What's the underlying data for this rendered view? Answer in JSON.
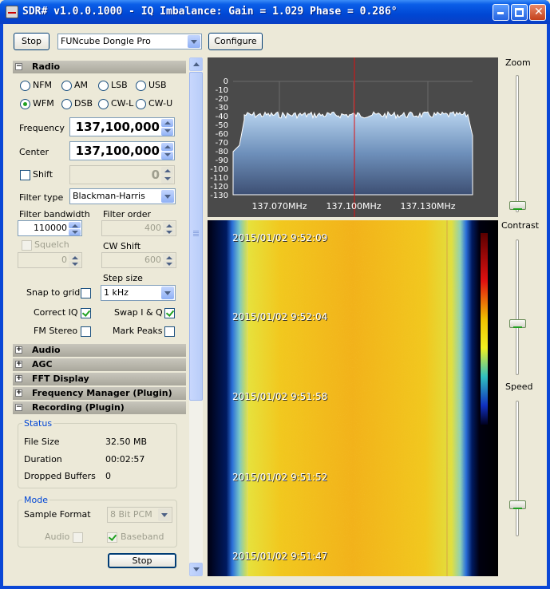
{
  "window": {
    "title": "SDR# v1.0.0.1000 - IQ Imbalance: Gain = 1.029 Phase = 0.286°"
  },
  "toolbar": {
    "stop_label": "Stop",
    "device": "FUNcube Dongle Pro",
    "configure_label": "Configure"
  },
  "radio": {
    "section_title": "Radio",
    "modes": [
      "NFM",
      "AM",
      "LSB",
      "USB",
      "WFM",
      "DSB",
      "CW-L",
      "CW-U"
    ],
    "selected_mode": "WFM",
    "frequency_label": "Frequency",
    "frequency_value": "137,100,000",
    "center_label": "Center",
    "center_value": "137,100,000",
    "shift_label": "Shift",
    "shift_value": "0",
    "filter_type_label": "Filter type",
    "filter_type_value": "Blackman-Harris",
    "filter_bandwidth_label": "Filter bandwidth",
    "filter_bandwidth_value": "110000",
    "filter_order_label": "Filter order",
    "filter_order_value": "400",
    "squelch_label": "Squelch",
    "squelch_value": "0",
    "cw_shift_label": "CW Shift",
    "cw_shift_value": "600",
    "step_size_label": "Step size",
    "snap_to_grid_label": "Snap to grid",
    "step_size_value": "1 kHz",
    "correct_iq_label": "Correct IQ",
    "swap_iq_label": "Swap I & Q",
    "fm_stereo_label": "FM Stereo",
    "mark_peaks_label": "Mark Peaks"
  },
  "sections": [
    "Audio",
    "AGC",
    "FFT Display",
    "Frequency Manager (Plugin)",
    "Recording (Plugin)"
  ],
  "recording": {
    "status_title": "Status",
    "file_size_label": "File Size",
    "file_size_value": "32.50 MB",
    "duration_label": "Duration",
    "duration_value": "00:02:57",
    "dropped_label": "Dropped Buffers",
    "dropped_value": "0",
    "mode_title": "Mode",
    "sample_format_label": "Sample Format",
    "sample_format_value": "8 Bit PCM",
    "audio_label": "Audio",
    "baseband_label": "Baseband",
    "stop_label": "Stop"
  },
  "spectrum": {
    "db_labels": [
      "0",
      "-10",
      "-20",
      "-30",
      "-40",
      "-50",
      "-60",
      "-70",
      "-80",
      "-90",
      "-100",
      "-110",
      "-120",
      "-130"
    ],
    "freq_labels": [
      "137.070MHz",
      "137.100MHz",
      "137.130MHz"
    ]
  },
  "waterfall": {
    "timestamps": [
      "2015/01/02 9:52:09",
      "2015/01/02 9:52:04",
      "2015/01/02 9:51:58",
      "2015/01/02 9:51:52",
      "2015/01/02 9:51:47"
    ]
  },
  "sliders": {
    "zoom_label": "Zoom",
    "contrast_label": "Contrast",
    "speed_label": "Speed"
  },
  "colors": {
    "title_blue": "#0047d4",
    "spectrum_bg": "#4a4a4a",
    "tuning_line": "#e01010",
    "accent_green": "#21a121"
  }
}
